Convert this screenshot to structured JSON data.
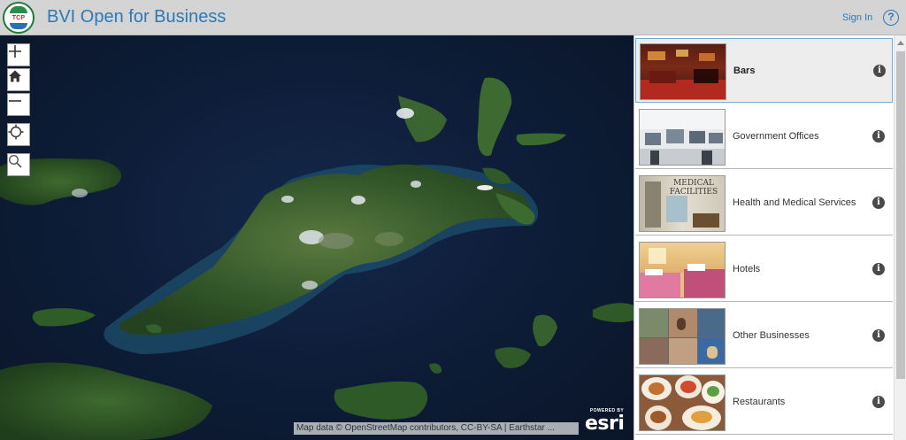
{
  "header": {
    "title": "BVI Open for Business",
    "logo_text": "TCP",
    "sign_in_label": "Sign In",
    "help_label": "?"
  },
  "map": {
    "controls": [
      {
        "name": "zoom-in-button",
        "icon": "plus-icon"
      },
      {
        "name": "home-button",
        "icon": "home-icon"
      },
      {
        "name": "zoom-out-button",
        "icon": "minus-icon"
      },
      {
        "name": "locate-button",
        "icon": "crosshair-icon"
      },
      {
        "name": "search-button",
        "icon": "search-icon"
      }
    ],
    "attribution": "Map data © OpenStreetMap contributors, CC-BY-SA | Earthstar ...",
    "esri": {
      "powered_by": "POWERED BY",
      "brand": "esri"
    },
    "colors": {
      "water": "#0d1c36",
      "land": "#2f5a2a",
      "cloud": "#e8ecef"
    }
  },
  "categories": {
    "selected": "Bars",
    "items": [
      {
        "label": "Bars",
        "thumbnail": "bar-interior-photo",
        "info": "i"
      },
      {
        "label": "Government Offices",
        "thumbnail": "office-cubicles-photo",
        "info": "i"
      },
      {
        "label": "Health and Medical Services",
        "thumbnail": "medical-facilities-photo",
        "info": "i"
      },
      {
        "label": "Hotels",
        "thumbnail": "hotel-room-photo",
        "info": "i"
      },
      {
        "label": "Other Businesses",
        "thumbnail": "business-collage-photo",
        "info": "i"
      },
      {
        "label": "Restaurants",
        "thumbnail": "food-plates-photo",
        "info": "i"
      }
    ],
    "medical_sign": "MEDICAL FACILITIES"
  }
}
